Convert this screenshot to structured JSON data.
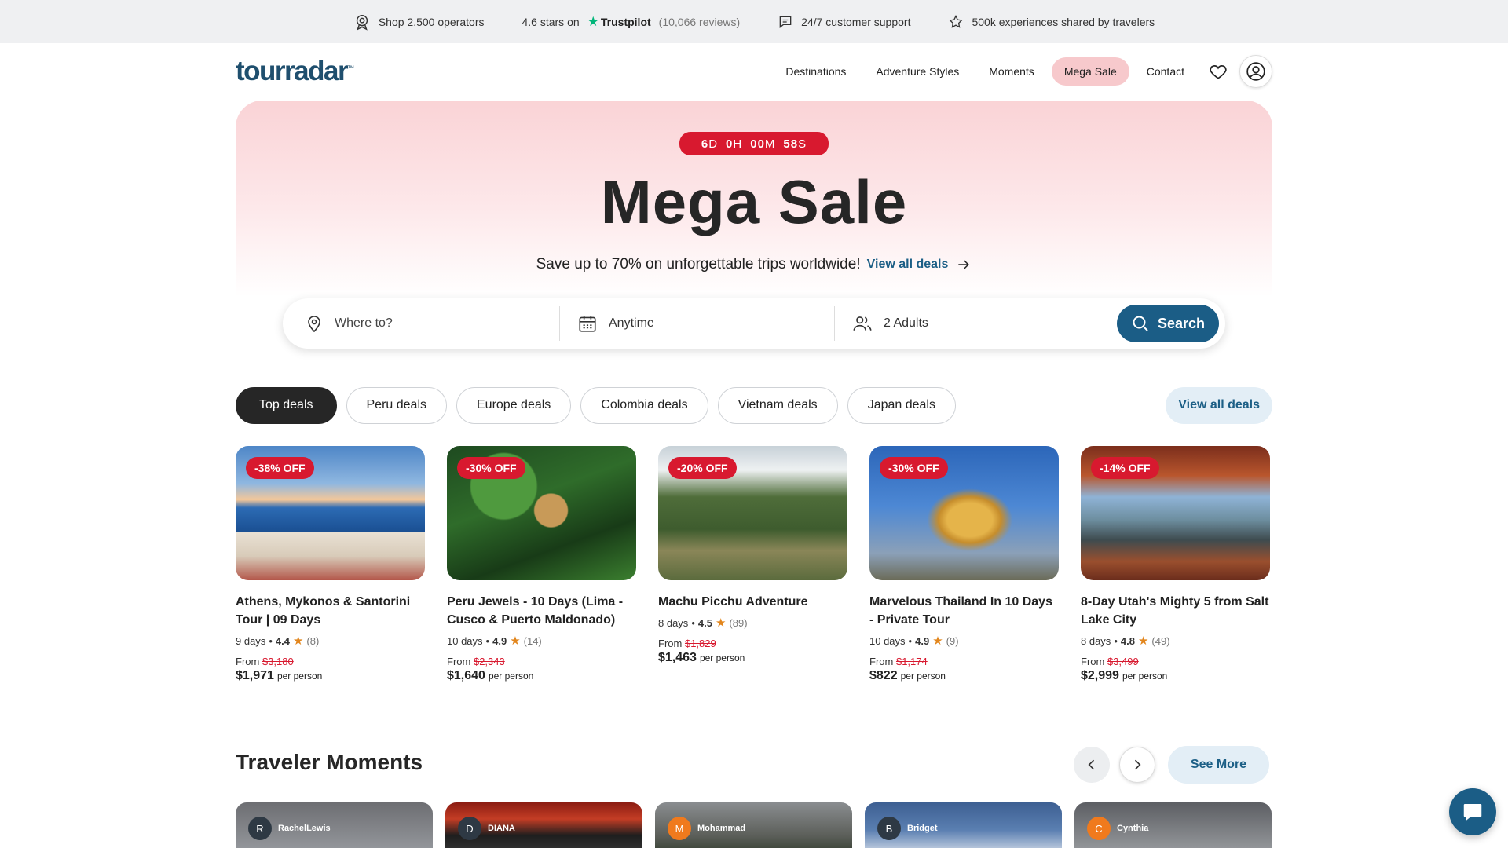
{
  "topbar": {
    "operators": "Shop 2,500 operators",
    "rating_prefix": "4.6 stars on",
    "trustpilot": "Trustpilot",
    "reviews": "(10,066 reviews)",
    "support": "24/7 customer support",
    "experiences": "500k experiences shared by travelers"
  },
  "header": {
    "logo": "tourradar",
    "logo_tm": "™",
    "nav": [
      "Destinations",
      "Adventure Styles",
      "Moments",
      "Mega Sale",
      "Contact"
    ]
  },
  "hero": {
    "countdown": {
      "days": "6",
      "days_unit": "D",
      "hours": "0",
      "hours_unit": "H",
      "minutes": "00",
      "minutes_unit": "M",
      "seconds": "58",
      "seconds_unit": "S"
    },
    "title": "Mega Sale",
    "subtitle": "Save up to 70% on unforgettable trips worldwide!",
    "link": "View all deals"
  },
  "search": {
    "where_placeholder": "Where to?",
    "when": "Anytime",
    "travelers": "2 Adults",
    "button": "Search"
  },
  "filters": {
    "chips": [
      "Top deals",
      "Peru deals",
      "Europe deals",
      "Colombia deals",
      "Vietnam deals",
      "Japan deals"
    ],
    "view_all": "View all deals"
  },
  "deals": [
    {
      "badge": "-38% OFF",
      "title": "Athens, Mykonos & Santorini Tour | 09 Days",
      "days": "9 days",
      "rating": "4.4",
      "reviews": "(8)",
      "from": "From",
      "old_price": "$3,180",
      "price": "$1,971",
      "per": "per person"
    },
    {
      "badge": "-30% OFF",
      "title": "Peru Jewels - 10 Days (Lima - Cusco & Puerto Maldonado)",
      "days": "10 days",
      "rating": "4.9",
      "reviews": "(14)",
      "from": "From",
      "old_price": "$2,343",
      "price": "$1,640",
      "per": "per person"
    },
    {
      "badge": "-20% OFF",
      "title": "Machu Picchu Adventure",
      "days": "8 days",
      "rating": "4.5",
      "reviews": "(89)",
      "from": "From",
      "old_price": "$1,829",
      "price": "$1,463",
      "per": "per person"
    },
    {
      "badge": "-30% OFF",
      "title": "Marvelous Thailand In 10 Days - Private Tour",
      "days": "10 days",
      "rating": "4.9",
      "reviews": "(9)",
      "from": "From",
      "old_price": "$1,174",
      "price": "$822",
      "per": "per person"
    },
    {
      "badge": "-14% OFF",
      "title": "8-Day Utah's Mighty 5 from Salt Lake City",
      "days": "8 days",
      "rating": "4.8",
      "reviews": "(49)",
      "from": "From",
      "old_price": "$3,499",
      "price": "$2,999",
      "per": "per person"
    }
  ],
  "moments": {
    "title": "Traveler Moments",
    "see_more": "See More",
    "items": [
      {
        "initial": "R",
        "name": "RachelLewis"
      },
      {
        "initial": "D",
        "name": "DIANA"
      },
      {
        "initial": "M",
        "name": "Mohammad"
      },
      {
        "initial": "B",
        "name": "Bridget"
      },
      {
        "initial": "C",
        "name": "Cynthia"
      }
    ]
  },
  "colors": {
    "brand": "#1b5d86",
    "sale_red": "#d8192f",
    "dark": "#262626",
    "trustpilot_green": "#00b67a",
    "star_orange": "#e2861d"
  }
}
